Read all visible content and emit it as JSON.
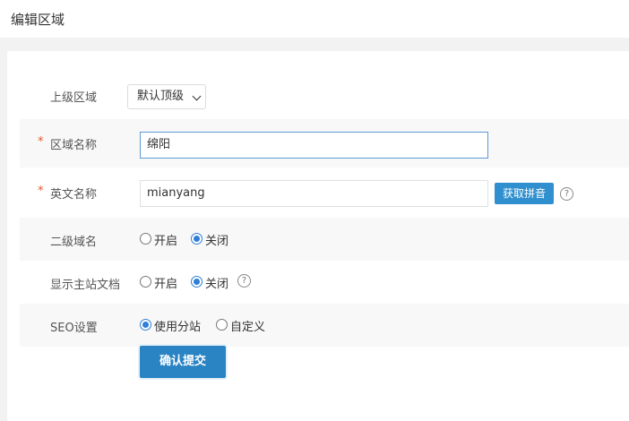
{
  "header": {
    "title": "编辑区域"
  },
  "form": {
    "parent_region": {
      "label": "上级区域",
      "value": "默认顶级"
    },
    "region_name": {
      "required_mark": "*",
      "label": "区域名称",
      "value": "绵阳"
    },
    "english_name": {
      "required_mark": "*",
      "label": "英文名称",
      "value": "mianyang",
      "pinyin_button": "获取拼音",
      "help": "?"
    },
    "subdomain": {
      "label": "二级域名",
      "options": [
        "开启",
        "关闭"
      ],
      "selected": "关闭"
    },
    "show_main_docs": {
      "label": "显示主站文档",
      "options": [
        "开启",
        "关闭"
      ],
      "selected": "关闭",
      "help": "?"
    },
    "seo": {
      "label": "SEO设置",
      "options": [
        "使用分站",
        "自定义"
      ],
      "selected": "使用分站"
    },
    "submit_label": "确认提交"
  },
  "colors": {
    "accent": "#2a83c2",
    "required": "#e4572e",
    "focus_border": "#5c9ad6"
  }
}
